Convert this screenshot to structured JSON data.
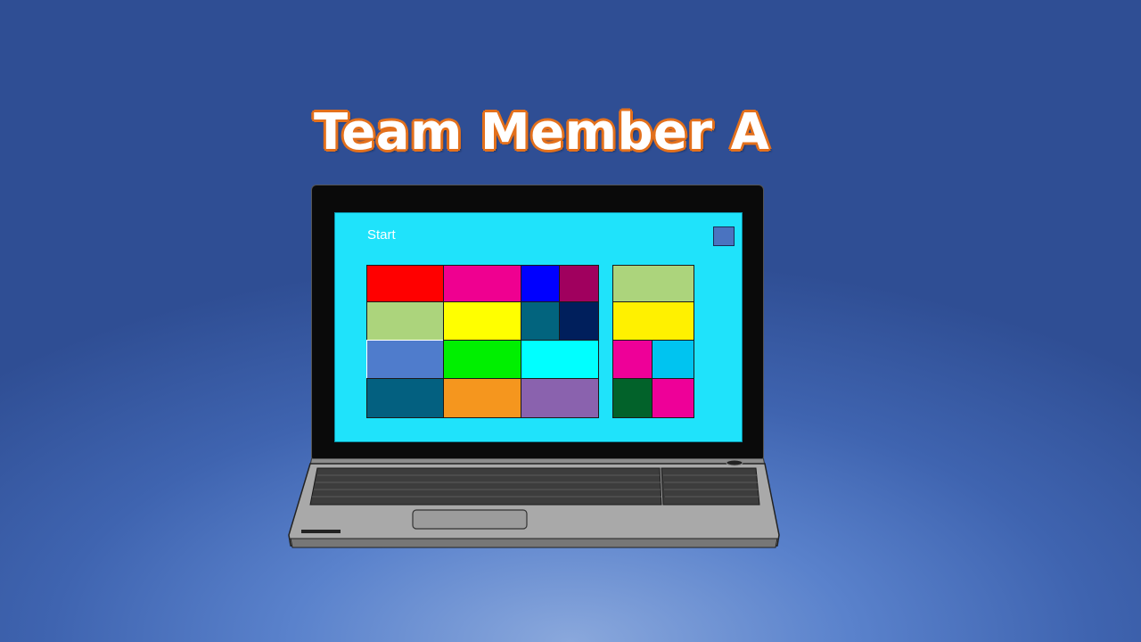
{
  "title": "Team Member A",
  "screen": {
    "start_label": "Start",
    "background_color": "#1fe3fb",
    "group1_tiles": [
      {
        "color": "#ff0000"
      },
      {
        "color": "#ef0090"
      },
      {
        "color": "#0000ff"
      },
      {
        "color": "#a0005e"
      },
      {
        "color": "#acd47c"
      },
      {
        "color": "#ffff00"
      },
      {
        "color": "#02647e"
      },
      {
        "color": "#001f5c"
      },
      {
        "color": "#4f7ccc"
      },
      {
        "color": "#00f000"
      },
      {
        "color": "#00ffff"
      },
      {
        "color": "#036080"
      },
      {
        "color": "#f5961e"
      },
      {
        "color": "#8a62ae"
      }
    ],
    "group2_tiles": [
      {
        "color": "#acd47c"
      },
      {
        "color": "#fff100"
      },
      {
        "color": "#ee0098"
      },
      {
        "color": "#00c4f0"
      },
      {
        "color": "#02622a"
      },
      {
        "color": "#ee0098"
      }
    ]
  },
  "colors": {
    "title_fill": "#ffffff",
    "title_outline": "#e3701c",
    "laptop_body": "#a6a6a6",
    "bezel": "#0a0a0a"
  }
}
